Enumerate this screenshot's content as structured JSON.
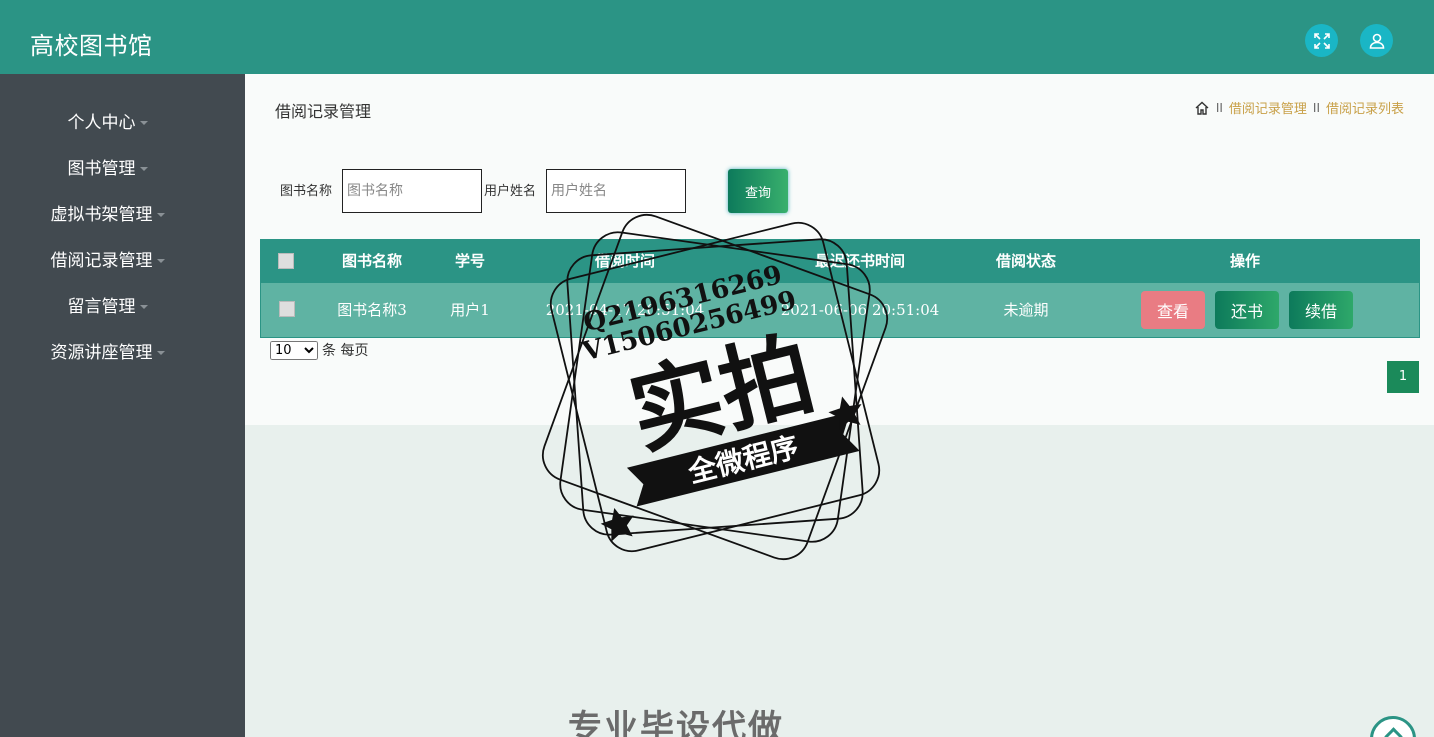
{
  "header": {
    "brand": "高校图书馆",
    "icons": [
      "fullscreen-icon",
      "user-icon"
    ],
    "color": "#2b9485"
  },
  "sidebar": {
    "items": [
      {
        "label": "个人中心"
      },
      {
        "label": "图书管理"
      },
      {
        "label": "虚拟书架管理"
      },
      {
        "label": "借阅记录管理"
      },
      {
        "label": "留言管理"
      },
      {
        "label": "资源讲座管理"
      }
    ]
  },
  "main": {
    "title": "借阅记录管理",
    "breadcrumb": {
      "sep": "II",
      "items": [
        "借阅记录管理",
        "借阅记录列表"
      ]
    },
    "search": {
      "book_label": "图书名称",
      "book_placeholder": "图书名称",
      "user_label": "用户姓名",
      "user_placeholder": "用户姓名",
      "query_label": "查询"
    },
    "table": {
      "columns": [
        "图书名称",
        "学号",
        "借阅时间",
        "最迟还书时间",
        "借阅状态",
        "操作"
      ],
      "rows": [
        {
          "book": "图书名称3",
          "student_id": "用户1",
          "borrow_time": "2021-04-17 20:51:04",
          "due_time": "2021-06-06 20:51:04",
          "status": "未逾期",
          "actions": {
            "view": "查看",
            "return": "还书",
            "renew": "续借"
          }
        }
      ]
    },
    "pagination": {
      "page_size": "10",
      "page_size_options": [
        "10"
      ],
      "page_size_suffix": "条 每页",
      "current_page": "1"
    },
    "colors": {
      "view_button": "#e97c83",
      "primary": "#1b8a5a"
    }
  },
  "watermark": {
    "line1": "Q2196316269",
    "line2": "V15060256499",
    "big": "实拍",
    "banner": "全微程序",
    "bottom_text": "专业毕设代做"
  }
}
